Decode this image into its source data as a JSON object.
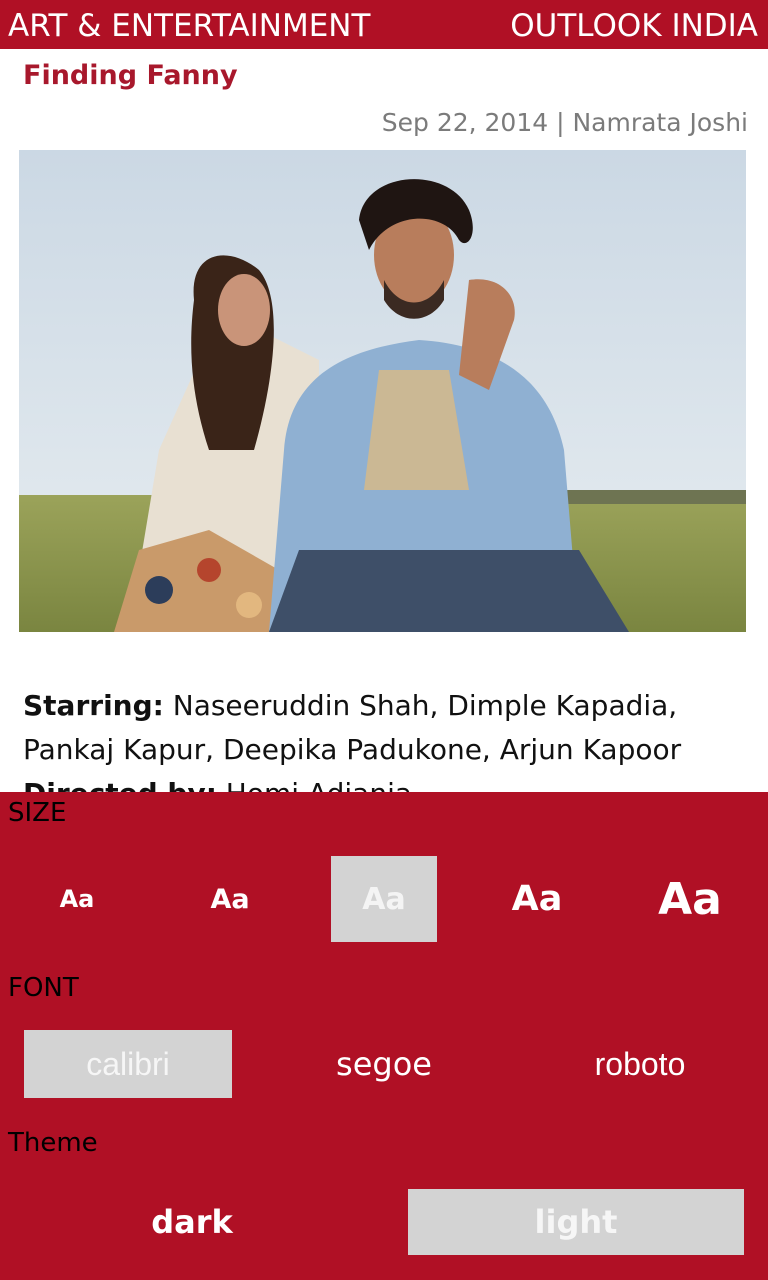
{
  "header": {
    "section": "ART & ENTERTAINMENT",
    "brand": "OUTLOOK INDIA"
  },
  "article": {
    "title": "Finding Fanny",
    "byline": "Sep 22, 2014 | Namrata Joshi",
    "starring_label": "Starring:",
    "starring_text": " Naseeruddin Shah, Dimple Kapadia, Pankaj Kapur, Deepika Padukone, Arjun Kapoor",
    "directed_label": "Directed by:",
    "directed_text": " Homi Adjania"
  },
  "settings": {
    "size_label": "SIZE",
    "size_options": [
      "Aa",
      "Aa",
      "Aa",
      "Aa",
      "Aa"
    ],
    "size_selected_index": 2,
    "font_label": "FONT",
    "font_options": [
      "calibri",
      "segoe",
      "roboto"
    ],
    "font_selected": "calibri",
    "theme_label": "Theme",
    "theme_options": [
      "dark",
      "light"
    ],
    "theme_selected": "light"
  },
  "colors": {
    "accent": "#b01025",
    "selected_bg": "#d3d3d3",
    "title": "#a8182c",
    "byline": "#7b7b7b"
  }
}
